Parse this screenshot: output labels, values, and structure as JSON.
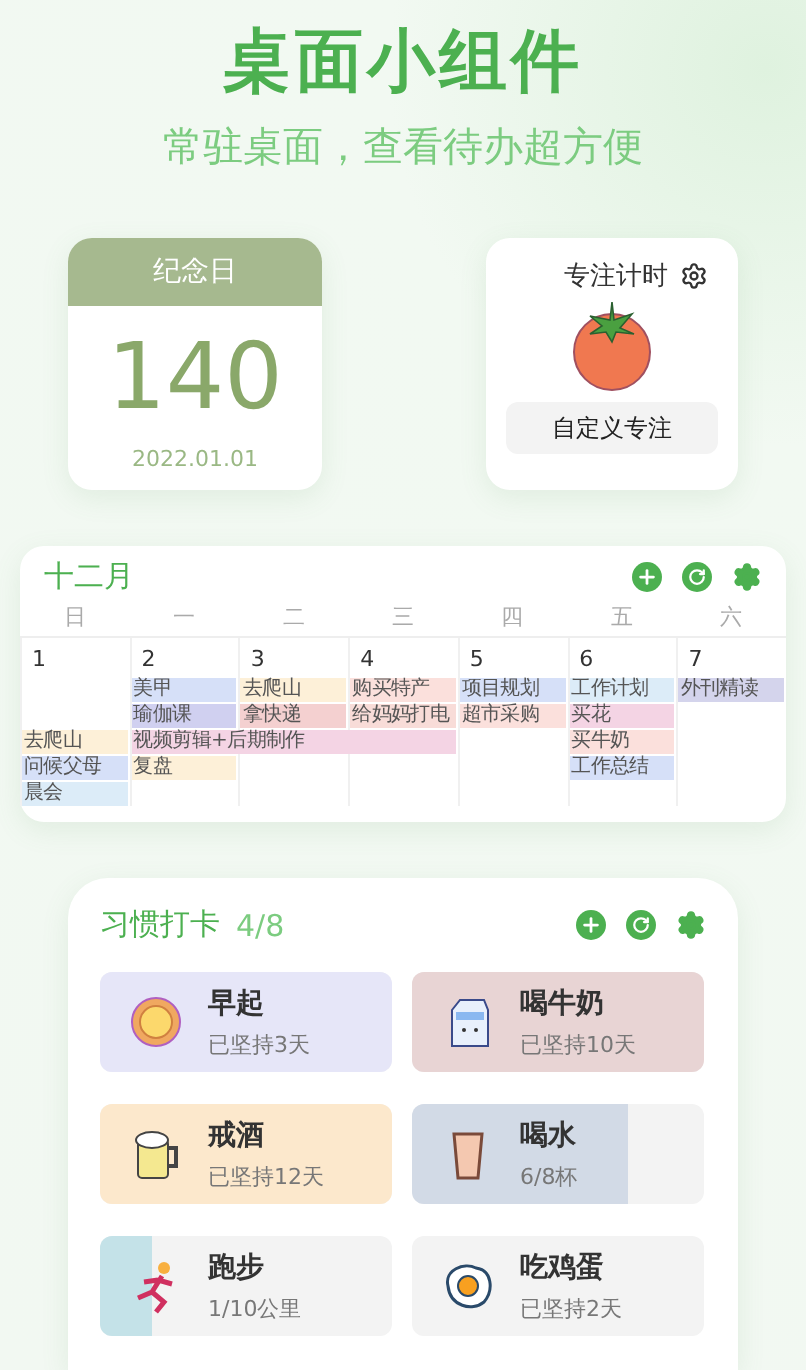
{
  "title": "桌面小组件",
  "subtitle": "常驻桌面，查看待办超方便",
  "anniversary": {
    "label": "纪念日",
    "days": "140",
    "date": "2022.01.01"
  },
  "focus": {
    "title": "专注计时",
    "button": "自定义专注"
  },
  "calendar": {
    "month": "十二月",
    "weekdays": [
      "日",
      "一",
      "二",
      "三",
      "四",
      "五",
      "六"
    ],
    "dates": [
      "1",
      "2",
      "3",
      "4",
      "5",
      "6",
      "7"
    ],
    "rows": [
      [
        {
          "kind": "empty"
        },
        {
          "kind": "event",
          "text": "美甲",
          "color": "#d6e0f8"
        },
        {
          "kind": "event",
          "text": "去爬山",
          "color": "#fdf0d8"
        },
        {
          "kind": "event",
          "text": "购买特产",
          "color": "#fbe0dc"
        },
        {
          "kind": "event",
          "text": "项目规划",
          "color": "#d6e0f8"
        },
        {
          "kind": "event",
          "text": "工作计划",
          "color": "#dcecf8"
        },
        {
          "kind": "event",
          "text": "外刊精读",
          "color": "#d4d4ec"
        }
      ],
      [
        {
          "kind": "empty"
        },
        {
          "kind": "event",
          "text": "瑜伽课",
          "color": "#d0d0f0"
        },
        {
          "kind": "event",
          "text": "拿快递",
          "color": "#f4d0d0"
        },
        {
          "kind": "event",
          "text": "给妈妈打电",
          "color": "#f8dcd8"
        },
        {
          "kind": "event",
          "text": "超市采购",
          "color": "#fbe0dc"
        },
        {
          "kind": "event",
          "text": "买花",
          "color": "#f4d4e4"
        }
      ],
      [
        {
          "kind": "event",
          "text": "去爬山",
          "color": "#fdf0d8"
        },
        {
          "kind": "wide",
          "text": "视频剪辑+后期制作",
          "color": "#f4d4e4"
        },
        {
          "kind": "covered"
        },
        {
          "kind": "covered"
        },
        {
          "kind": "empty"
        },
        {
          "kind": "event",
          "text": "买牛奶",
          "color": "#fbe0dc"
        }
      ],
      [
        {
          "kind": "event",
          "text": "问候父母",
          "color": "#d6e0f8"
        },
        {
          "kind": "event",
          "text": "复盘",
          "color": "#fdf0d8"
        },
        {
          "kind": "empty"
        },
        {
          "kind": "empty"
        },
        {
          "kind": "empty"
        },
        {
          "kind": "event",
          "text": "工作总结",
          "color": "#d6e0f8"
        }
      ],
      [
        {
          "kind": "event",
          "text": "晨会",
          "color": "#dcecf8"
        }
      ]
    ]
  },
  "habits": {
    "title": "习惯打卡",
    "count": "4/8",
    "items": [
      {
        "name": "早起",
        "note": "已坚持3天",
        "color": "#e6e6f8",
        "done": true
      },
      {
        "name": "喝牛奶",
        "note": "已坚持10天",
        "color": "#e8d4d4",
        "done": true
      },
      {
        "name": "戒酒",
        "note": "已坚持12天",
        "color": "#fce8cc",
        "done": true
      },
      {
        "name": "喝水",
        "note": "6/8杯",
        "color": "#d2dae6",
        "level": 0.74
      },
      {
        "name": "跑步",
        "note": "1/10公里",
        "color": "#c4e2e8",
        "level": 0.18
      },
      {
        "name": "吃鸡蛋",
        "note": "已坚持2天",
        "done": false
      }
    ]
  }
}
